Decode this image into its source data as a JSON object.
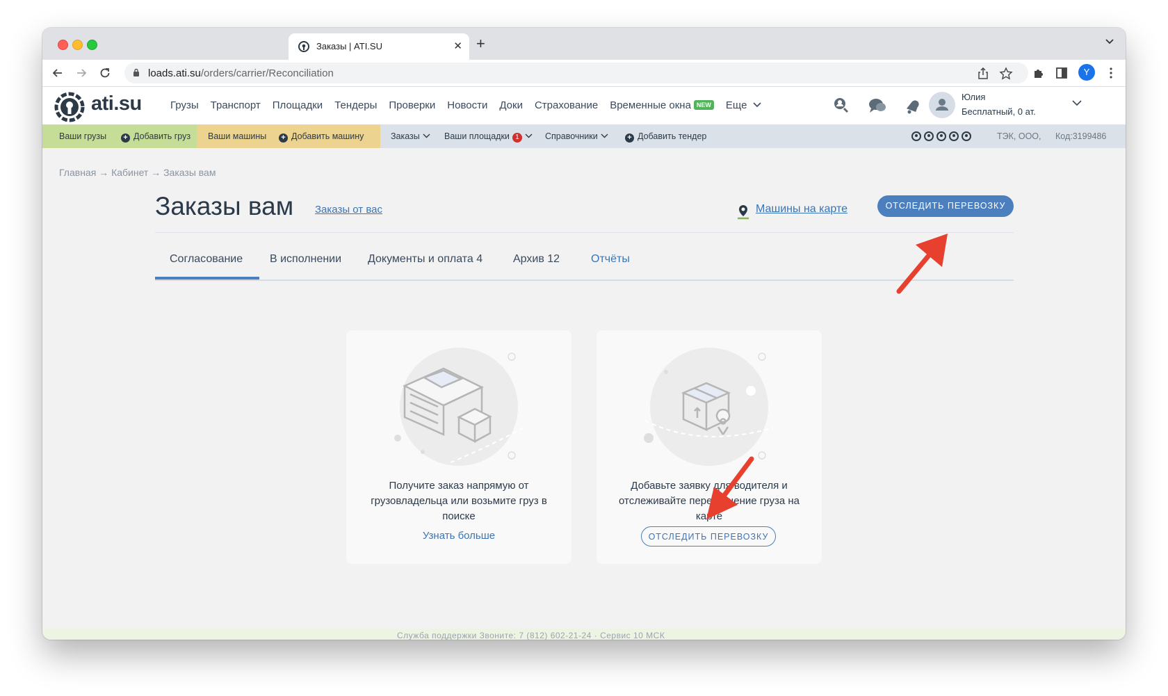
{
  "browser": {
    "tab_title": "Заказы | ATI.SU",
    "url_host": "loads.ati.su",
    "url_path": "/orders/carrier/Reconciliation",
    "profile_initial": "Y"
  },
  "site": {
    "logo_text": "ati.su",
    "nav": [
      "Грузы",
      "Транспорт",
      "Площадки",
      "Тендеры",
      "Проверки",
      "Новости",
      "Доки",
      "Страхование",
      "Временные окна"
    ],
    "new_badge": "NEW",
    "more": "Еще",
    "user_name": "Юлия",
    "user_plan": "Бесплатный,  0 ат."
  },
  "subnav": {
    "your_loads": "Ваши грузы",
    "add_load": "Добавить груз",
    "your_trucks": "Ваши машины",
    "add_truck": "Добавить машину",
    "orders": "Заказы",
    "your_platforms": "Ваши площадки",
    "platforms_badge": "1",
    "directories": "Справочники",
    "add_tender": "Добавить тендер",
    "company": "ТЭК, ООО,",
    "code": "Код:3199486"
  },
  "page": {
    "breadcrumb": "Главная → Кабинет → Заказы вам",
    "title": "Заказы вам",
    "orders_from_you": "Заказы от вас",
    "map_link": "Машины на карте",
    "track_button": "ОТСЛЕДИТЬ ПЕРЕВОЗКУ",
    "tabs": [
      "Согласование",
      "В исполнении",
      "Документы и оплата  4",
      "Архив  12",
      "Отчёты"
    ]
  },
  "cards": {
    "left_text": "Получите заказ напрямую от грузовладельца или возьмите груз в поиске",
    "left_link": "Узнать больше",
    "right_text": "Добавьте заявку для водителя и отслеживайте перемещение груза на карте",
    "right_button": "ОТСЛЕДИТЬ ПЕРЕВОЗКУ"
  },
  "footer": {
    "text": "Служба поддержки   Звоните: 7 (812) 602-21-24 · Сервис 10 МСК"
  },
  "colors": {
    "accent": "#4c7fbd",
    "link": "#3b74b5",
    "annotation_arrow": "#e8402e",
    "subnav_green": "#c5dd96",
    "subnav_yellow": "#ecd390"
  }
}
